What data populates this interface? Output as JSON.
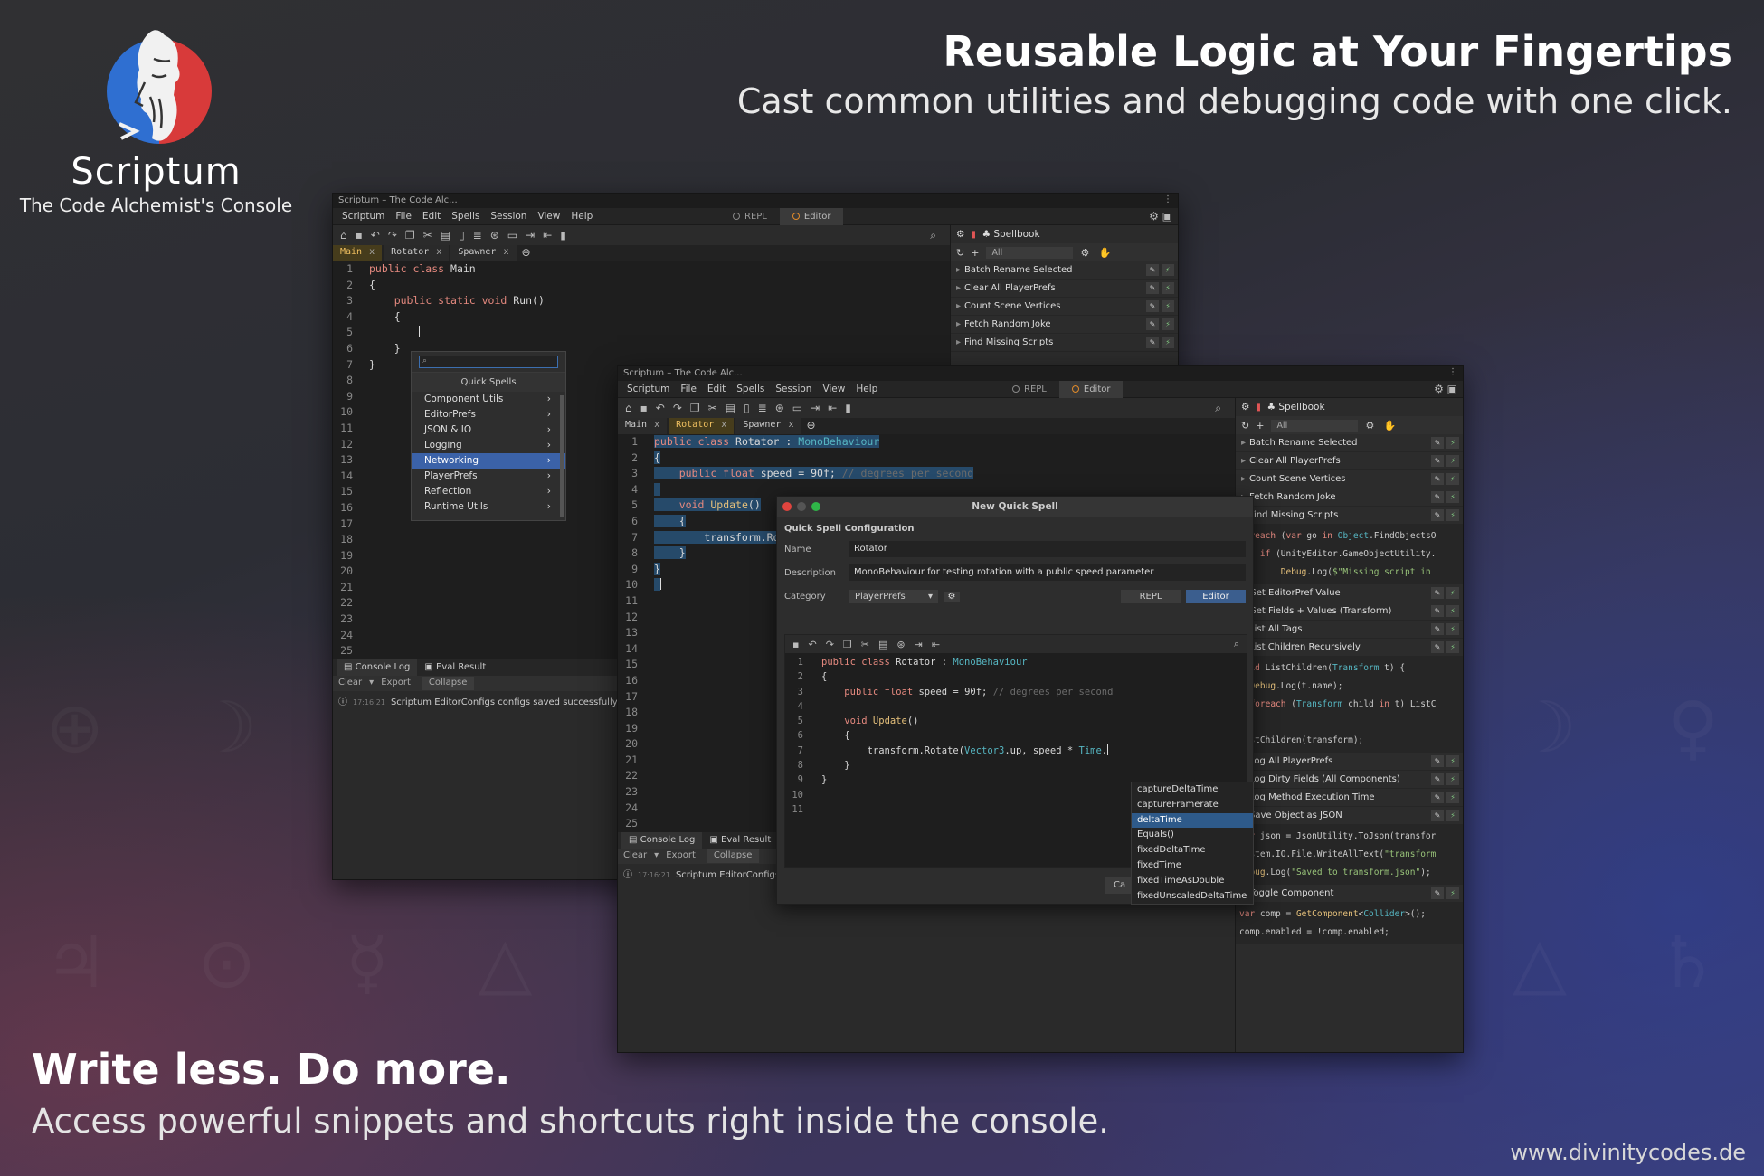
{
  "hero": {
    "title": "Reusable Logic at Your Fingertips",
    "subtitle": "Cast common utilities and debugging code with one click."
  },
  "brand": {
    "name": "Scriptum",
    "tagline": "The Code Alchemist's Console"
  },
  "footer": {
    "title": "Write less. Do more.",
    "subtitle": "Access powerful snippets and shortcuts right inside the console.",
    "website": "www.divinitycodes.de"
  },
  "window_back": {
    "title": "Scriptum – The Code Alc...",
    "menu": [
      "Scriptum",
      "File",
      "Edit",
      "Spells",
      "Session",
      "View",
      "Help"
    ],
    "modes": [
      "REPL",
      "Editor"
    ],
    "tabs": [
      "Main",
      "Rotator",
      "Spawner"
    ],
    "active_tab": "Main",
    "line_numbers": [
      "1",
      "2",
      "3",
      "4",
      "5",
      "6",
      "7",
      "8",
      "9",
      "10",
      "11",
      "12",
      "13",
      "14",
      "15",
      "16",
      "17",
      "18",
      "19",
      "20",
      "21",
      "22",
      "23",
      "24",
      "25"
    ],
    "console": {
      "tabs": [
        "Console Log",
        "Eval Result"
      ],
      "actions": [
        "Clear",
        "Export",
        "Collapse"
      ],
      "time": "17:16:21",
      "message": "Scriptum EditorConfigs configs saved successfully."
    },
    "spellbook": {
      "title": "Spellbook",
      "filter": "All",
      "items": [
        "Batch Rename Selected",
        "Clear All PlayerPrefs",
        "Count Scene Vertices",
        "Fetch Random Joke",
        "Find Missing Scripts"
      ]
    }
  },
  "quick_spells": {
    "search_placeholder": "",
    "title": "Quick Spells",
    "items": [
      "Component Utils",
      "EditorPrefs",
      "JSON & IO",
      "Logging",
      "Networking",
      "PlayerPrefs",
      "Reflection",
      "Runtime Utils"
    ],
    "highlighted": "Networking"
  },
  "window_front": {
    "title": "Scriptum – The Code Alc...",
    "menu": [
      "Scriptum",
      "File",
      "Edit",
      "Spells",
      "Session",
      "View",
      "Help"
    ],
    "modes": [
      "REPL",
      "Editor"
    ],
    "tabs": [
      "Main",
      "Rotator",
      "Spawner"
    ],
    "active_tab": "Rotator",
    "line_numbers": [
      "1",
      "2",
      "3",
      "4",
      "5",
      "6",
      "7",
      "8",
      "9",
      "10",
      "11",
      "12",
      "13",
      "14",
      "15",
      "16",
      "17",
      "18",
      "19",
      "20",
      "21",
      "22",
      "23",
      "24",
      "25"
    ],
    "console": {
      "tabs": [
        "Console Log",
        "Eval Result"
      ],
      "actions": [
        "Clear",
        "Export",
        "Collapse"
      ],
      "time": "17:16:21",
      "message": "Scriptum EditorConfigs"
    },
    "spellbook": {
      "title": "Spellbook",
      "filter": "All",
      "items_top": [
        "Batch Rename Selected",
        "Clear All PlayerPrefs",
        "Count Scene Vertices",
        "Fetch Random Joke",
        "Find Missing Scripts"
      ],
      "items_mid": [
        "Get EditorPref Value",
        "Get Fields + Values (Transform)",
        "List All Tags",
        "List Children Recursively"
      ],
      "items_log": [
        "Log All PlayerPrefs",
        "Log Dirty Fields (All Components)",
        "Log Method Execution Time",
        "Save Object as JSON"
      ],
      "items_end": [
        "Toggle Component"
      ]
    }
  },
  "dialog": {
    "title": "New Quick Spell",
    "section": "Quick Spell Configuration",
    "name_label": "Name",
    "name_value": "Rotator",
    "desc_label": "Description",
    "desc_value": "MonoBehaviour for testing rotation with a public speed parameter",
    "cat_label": "Category",
    "cat_value": "PlayerPrefs",
    "mode_repl": "REPL",
    "mode_editor": "Editor",
    "line_numbers": [
      "1",
      "2",
      "3",
      "4",
      "5",
      "6",
      "7",
      "8",
      "9",
      "10",
      "11"
    ],
    "cancel": "Ca"
  },
  "autocomplete": {
    "items": [
      "captureDeltaTime",
      "captureFramerate",
      "deltaTime",
      "Equals()",
      "fixedDeltaTime",
      "fixedTime",
      "fixedTimeAsDouble",
      "fixedUnscaledDeltaTime"
    ],
    "highlighted": "deltaTime"
  }
}
